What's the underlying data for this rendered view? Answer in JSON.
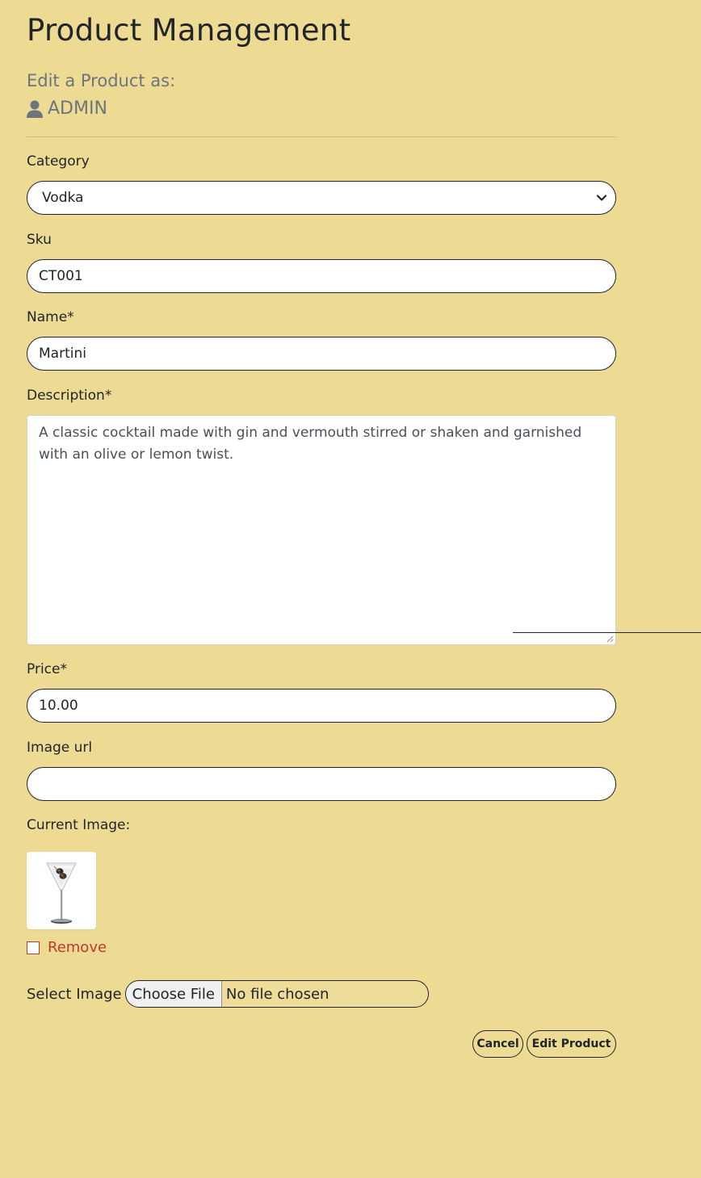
{
  "page": {
    "title": "Product Management",
    "subtitle": "Edit a Product as:",
    "user": "ADMIN"
  },
  "form": {
    "category": {
      "label": "Category",
      "value": "Vodka"
    },
    "sku": {
      "label": "Sku",
      "value": "CT001"
    },
    "name": {
      "label": "Name*",
      "value": "Martini"
    },
    "description": {
      "label": "Description*",
      "value": "A classic cocktail made with gin and vermouth stirred or shaken and garnished with an olive or lemon twist."
    },
    "price": {
      "label": "Price*",
      "value": "10.00"
    },
    "image_url": {
      "label": "Image url",
      "value": ""
    },
    "current_image": {
      "label": "Current Image:"
    },
    "remove": {
      "label": "Remove",
      "checked": false
    },
    "select_image": {
      "label": "Select Image",
      "button": "Choose File",
      "status": "No file chosen"
    }
  },
  "actions": {
    "cancel": "Cancel",
    "submit": "Edit Product"
  },
  "colors": {
    "background": "#edda93",
    "text": "#212529",
    "muted": "#6c757d",
    "danger": "#c0392b"
  },
  "icons": {
    "user": "user-icon",
    "select": "chevron-down-icon"
  }
}
